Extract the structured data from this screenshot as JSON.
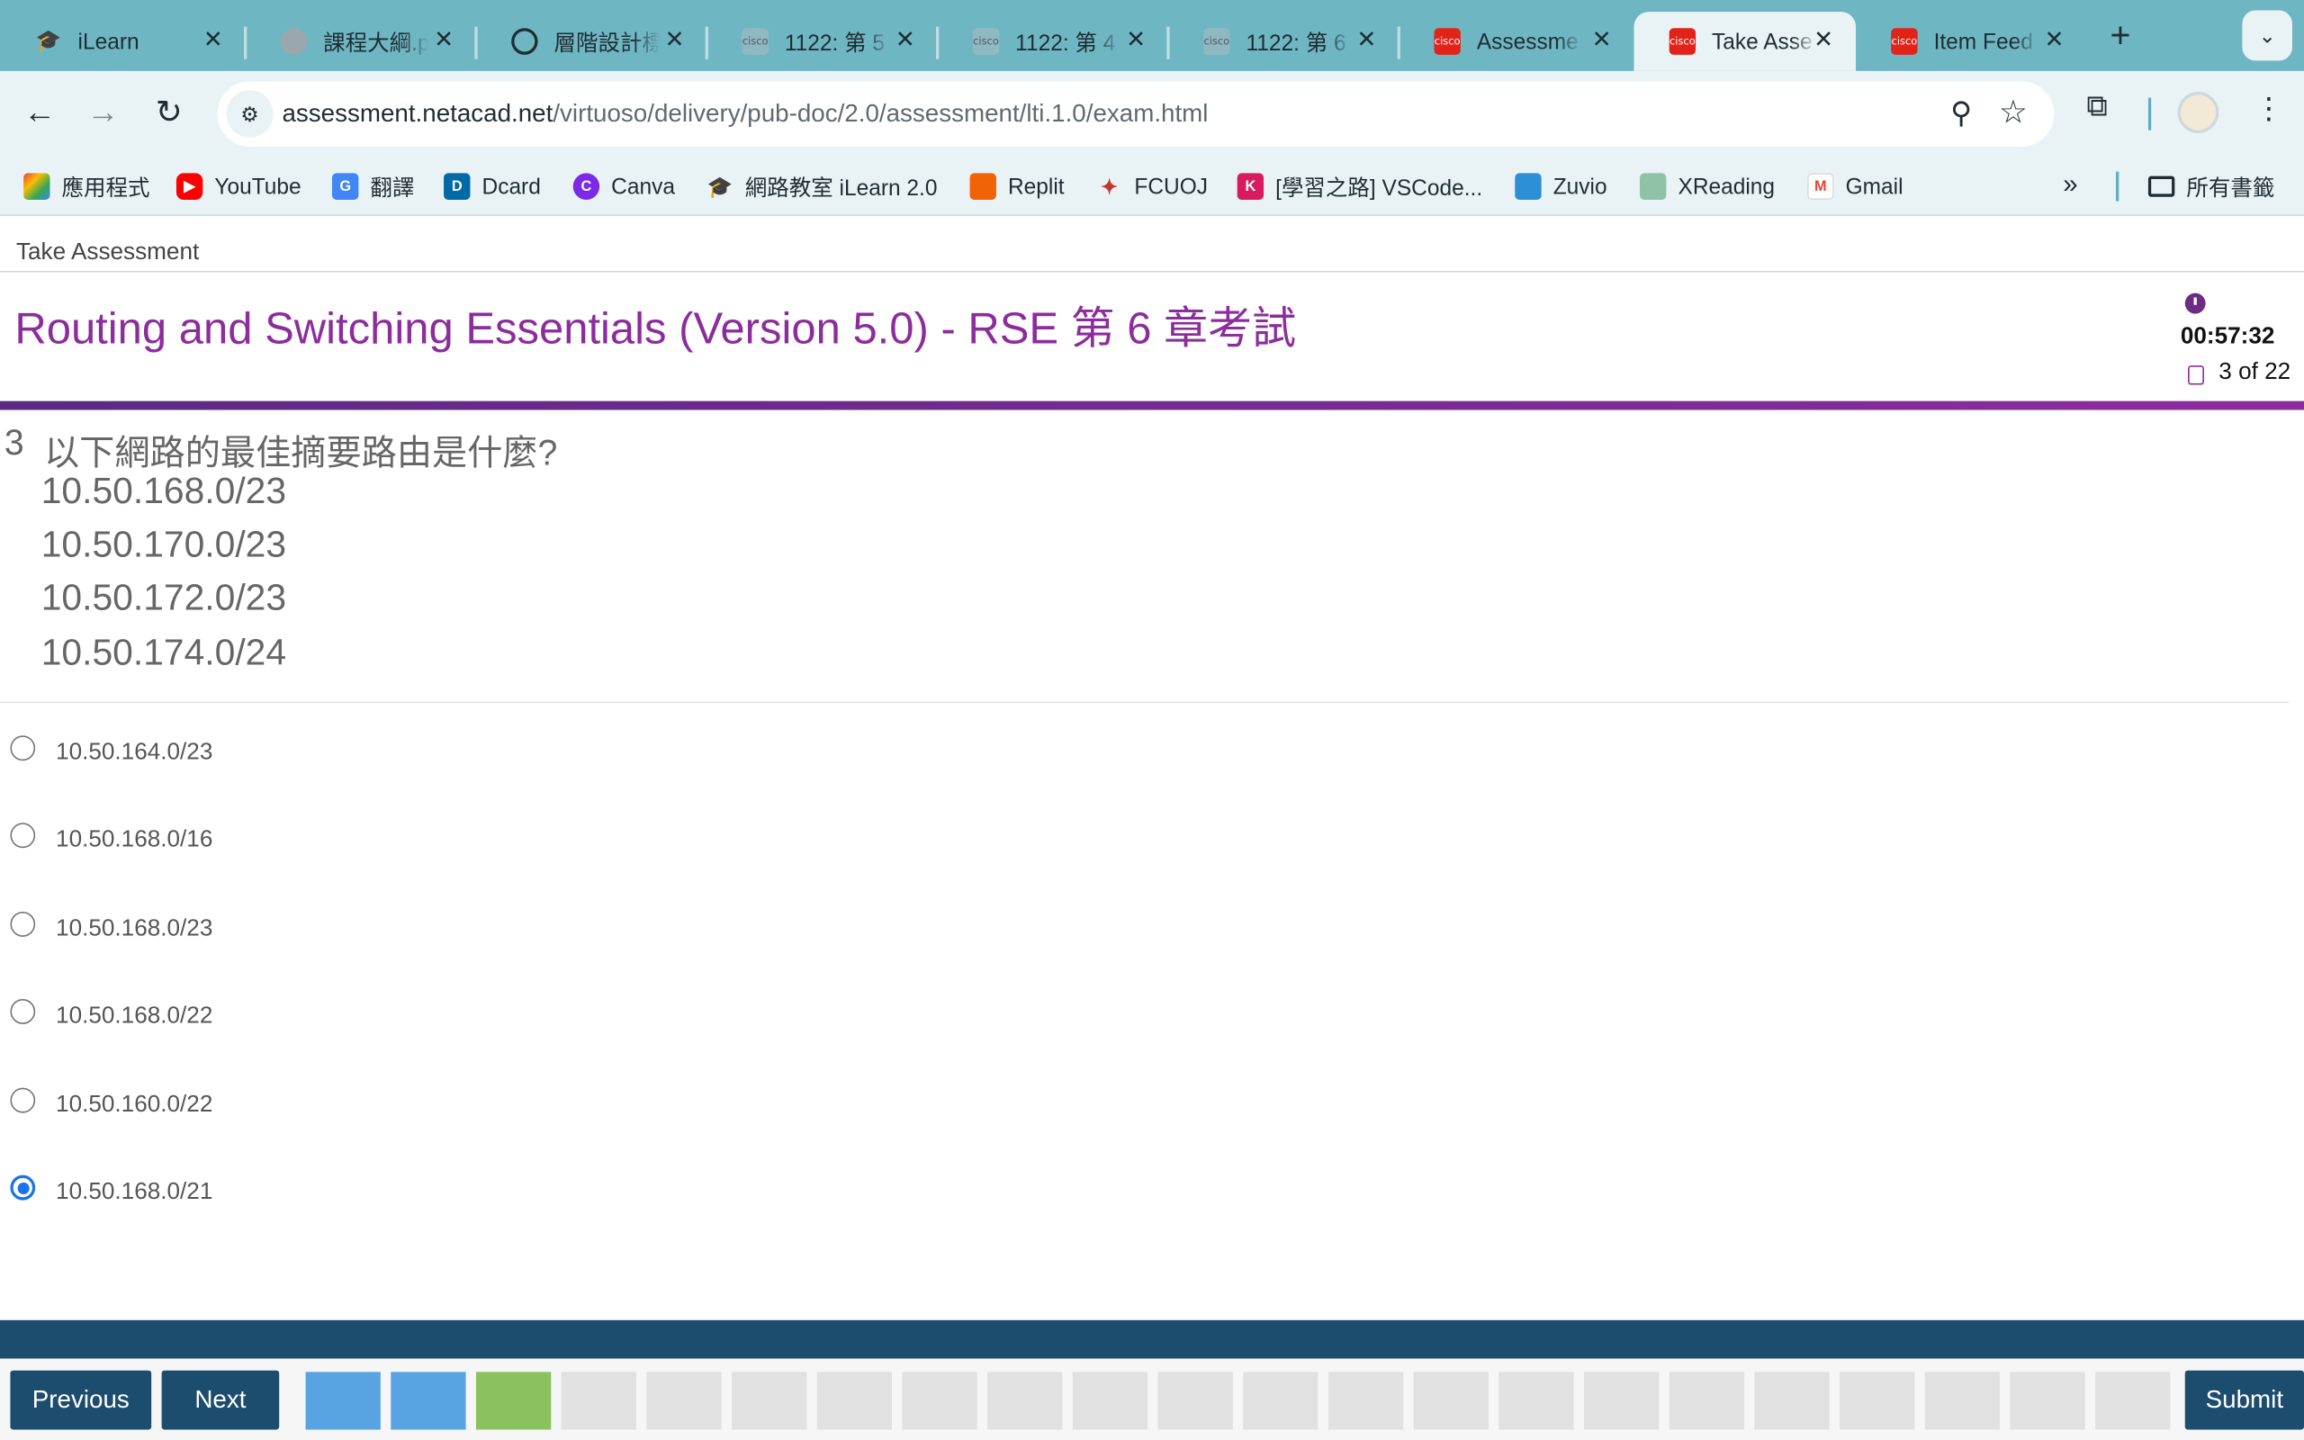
{
  "browser": {
    "tabs": [
      {
        "title": "iLearn",
        "icon": "ilearn-icon",
        "active": false
      },
      {
        "title": "課程大綱.p",
        "icon": "course-icon",
        "active": false
      },
      {
        "title": "層階設計標",
        "icon": "openai-icon",
        "active": false
      },
      {
        "title": "1122: 第 5",
        "icon": "cisco-icon",
        "active": false
      },
      {
        "title": "1122: 第 4",
        "icon": "cisco-icon",
        "active": false
      },
      {
        "title": "1122: 第 6",
        "icon": "cisco-icon",
        "active": false
      },
      {
        "title": "Assessme",
        "icon": "cisco-icon",
        "active": false
      },
      {
        "title": "Take Asse",
        "icon": "cisco-icon",
        "active": true
      },
      {
        "title": "Item Feed",
        "icon": "cisco-icon",
        "active": false
      }
    ],
    "close_glyph": "✕",
    "new_tab_glyph": "+",
    "tab_menu_glyph": "⌄",
    "url_host": "assessment.netacad.net",
    "url_path": "/virtuoso/delivery/pub-doc/2.0/assessment/lti.1.0/exam.html",
    "bookmarks": [
      {
        "label": "應用程式",
        "icon": "apps-grid-icon"
      },
      {
        "label": "YouTube",
        "icon": "youtube-icon"
      },
      {
        "label": "翻譯",
        "icon": "translate-icon"
      },
      {
        "label": "Dcard",
        "icon": "dcard-icon"
      },
      {
        "label": "Canva",
        "icon": "canva-icon"
      },
      {
        "label": "網路教室 iLearn 2.0",
        "icon": "ilearn-icon"
      },
      {
        "label": "Replit",
        "icon": "replit-icon"
      },
      {
        "label": "FCUOJ",
        "icon": "fcuoj-icon"
      },
      {
        "label": "[學習之路] VSCode...",
        "icon": "bookmark-k-icon"
      },
      {
        "label": "Zuvio",
        "icon": "zuvio-icon"
      },
      {
        "label": "XReading",
        "icon": "xreading-icon"
      },
      {
        "label": "Gmail",
        "icon": "gmail-icon"
      }
    ],
    "all_bookmarks": "所有書籤"
  },
  "page": {
    "breadcrumb": "Take Assessment",
    "title": "Routing and Switching Essentials (Version 5.0) - RSE 第 6 章考試",
    "timer": "00:57:32",
    "progress": "3 of 22",
    "accent_color": "#8c2d9c"
  },
  "question": {
    "number": "3",
    "text": "以下網路的最佳摘要路由是什麼?",
    "networks": [
      "10.50.168.0/23",
      "10.50.170.0/23",
      "10.50.172.0/23",
      "10.50.174.0/24"
    ],
    "options": [
      {
        "label": "10.50.164.0/23",
        "selected": false
      },
      {
        "label": "10.50.168.0/16",
        "selected": false
      },
      {
        "label": "10.50.168.0/23",
        "selected": false
      },
      {
        "label": "10.50.168.0/22",
        "selected": false
      },
      {
        "label": "10.50.160.0/22",
        "selected": false
      },
      {
        "label": "10.50.168.0/21",
        "selected": true
      }
    ]
  },
  "footer": {
    "previous": "Previous",
    "next": "Next",
    "submit": "Submit",
    "question_states": [
      "answered",
      "answered",
      "current",
      "unanswered",
      "unanswered",
      "unanswered",
      "unanswered",
      "unanswered",
      "unanswered",
      "unanswered",
      "unanswered",
      "unanswered",
      "unanswered",
      "unanswered",
      "unanswered",
      "unanswered",
      "unanswered",
      "unanswered",
      "unanswered",
      "unanswered",
      "unanswered",
      "unanswered"
    ],
    "colors": {
      "bar": "#1d4d6e",
      "answered": "#5aa3e2",
      "current": "#8bc15e",
      "unanswered": "#e1e1e1"
    }
  }
}
